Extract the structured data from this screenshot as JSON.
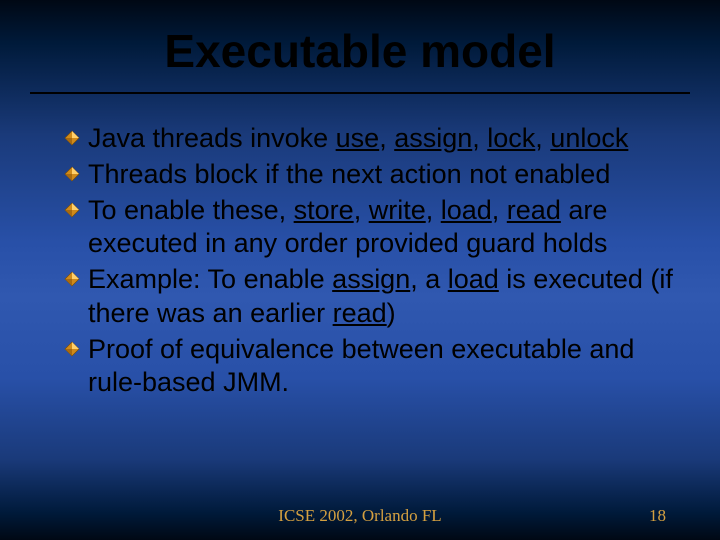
{
  "title": "Executable model",
  "bullets": [
    {
      "segments": [
        {
          "t": "Java threads invoke "
        },
        {
          "t": "use",
          "u": true
        },
        {
          "t": ", "
        },
        {
          "t": "assign",
          "u": true
        },
        {
          "t": ", "
        },
        {
          "t": "lock",
          "u": true
        },
        {
          "t": ", "
        },
        {
          "t": "unlock",
          "u": true
        }
      ]
    },
    {
      "segments": [
        {
          "t": "Threads block if the next action not enabled"
        }
      ]
    },
    {
      "segments": [
        {
          "t": "To enable these, "
        },
        {
          "t": "store",
          "u": true
        },
        {
          "t": ", "
        },
        {
          "t": "write",
          "u": true
        },
        {
          "t": ", "
        },
        {
          "t": "load",
          "u": true
        },
        {
          "t": ", "
        },
        {
          "t": "read",
          "u": true
        },
        {
          "t": " are executed in any order provided guard holds"
        }
      ]
    },
    {
      "segments": [
        {
          "t": "Example: To enable "
        },
        {
          "t": "assign",
          "u": true
        },
        {
          "t": ", a "
        },
        {
          "t": "load",
          "u": true
        },
        {
          "t": " is executed (if there was an earlier "
        },
        {
          "t": "read",
          "u": true
        },
        {
          "t": ")"
        }
      ]
    },
    {
      "segments": [
        {
          "t": "Proof of equivalence between executable and rule-based JMM."
        }
      ]
    }
  ],
  "footer": "ICSE 2002, Orlando FL",
  "page_number": "18",
  "colors": {
    "bullet_fill": "#d08a1a",
    "bullet_edge": "#7a4a00",
    "accent_text": "#d4a040"
  }
}
